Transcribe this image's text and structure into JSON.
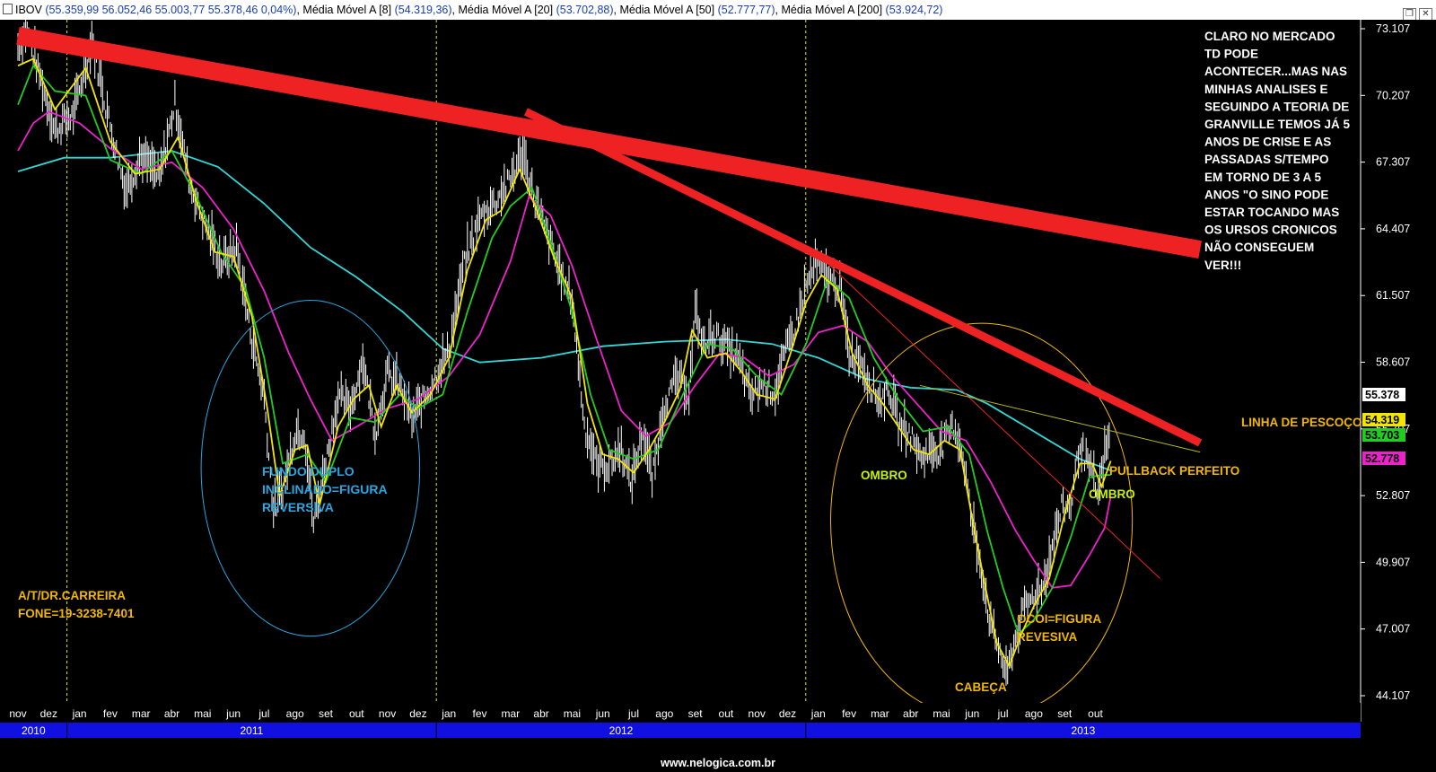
{
  "header": {
    "symbol": "IBOV",
    "ohlc": "(55.359,99  56.052,46  55.003,77  55.378,46  0,04%)",
    "ma": [
      {
        "label": "Média Móvel A [8]",
        "value": "(54.319,36)"
      },
      {
        "label": "Média Móvel A [20]",
        "value": "(53.702,88)"
      },
      {
        "label": "Média Móvel A [50]",
        "value": "(52.777,77)"
      },
      {
        "label": "Média Móvel A [200]",
        "value": "(53.924,72)"
      }
    ]
  },
  "footer": {
    "watermark": "www.nelogica.com.br"
  },
  "colors": {
    "background": "#000000",
    "price": "#ffffff",
    "ma8": "#f2e600",
    "ma20": "#22cc22",
    "ma50": "#ee22cc",
    "ma200": "#33d6d6",
    "trend": "#ee2222",
    "annot_blue": "#2aa6e0",
    "annot_orange": "#f2b800",
    "annot_green": "#c8f000",
    "axis_band": "#1010e0"
  },
  "chart_data": {
    "type": "line",
    "ylim": [
      44107,
      73107
    ],
    "y_ticks": [
      "73.107",
      "70.207",
      "67.307",
      "64.407",
      "61.507",
      "58.607",
      "55.707",
      "52.807",
      "49.907",
      "47.007",
      "44.107"
    ],
    "months": [
      "nov",
      "dez",
      "jan",
      "fev",
      "mar",
      "abr",
      "mai",
      "jun",
      "jul",
      "ago",
      "set",
      "out",
      "nov",
      "dez",
      "jan",
      "fev",
      "mar",
      "abr",
      "mai",
      "jun",
      "jul",
      "ago",
      "set",
      "out",
      "nov",
      "dez",
      "jan",
      "fev",
      "mar",
      "abr",
      "mai",
      "jun",
      "jul",
      "ago",
      "set",
      "out"
    ],
    "years": [
      "2010",
      "2011",
      "2012",
      "2013"
    ],
    "year_start_index": [
      0,
      2,
      14,
      26
    ],
    "price_keypoints": [
      [
        0,
        72200
      ],
      [
        0.3,
        73000
      ],
      [
        0.7,
        71000
      ],
      [
        1.2,
        68600
      ],
      [
        1.8,
        69300
      ],
      [
        2.4,
        72500
      ],
      [
        3.0,
        68800
      ],
      [
        3.5,
        66000
      ],
      [
        4.0,
        67500
      ],
      [
        4.6,
        66500
      ],
      [
        5.1,
        69800
      ],
      [
        5.6,
        66200
      ],
      [
        6.1,
        64500
      ],
      [
        6.6,
        62800
      ],
      [
        7.1,
        63500
      ],
      [
        7.6,
        59500
      ],
      [
        8.0,
        57000
      ],
      [
        8.3,
        52000
      ],
      [
        8.6,
        53000
      ],
      [
        9.0,
        55500
      ],
      [
        9.3,
        55500
      ],
      [
        9.6,
        51500
      ],
      [
        9.9,
        53500
      ],
      [
        10.4,
        57000
      ],
      [
        10.8,
        56500
      ],
      [
        11.2,
        58600
      ],
      [
        11.6,
        55500
      ],
      [
        12.0,
        58000
      ],
      [
        12.4,
        57500
      ],
      [
        12.8,
        56000
      ],
      [
        13.2,
        57000
      ],
      [
        13.6,
        58000
      ],
      [
        14.0,
        59000
      ],
      [
        14.5,
        62800
      ],
      [
        15.0,
        64800
      ],
      [
        15.5,
        65500
      ],
      [
        16.0,
        66500
      ],
      [
        16.4,
        67600
      ],
      [
        16.8,
        65500
      ],
      [
        17.2,
        64000
      ],
      [
        17.6,
        62500
      ],
      [
        18.0,
        61200
      ],
      [
        18.4,
        55800
      ],
      [
        18.8,
        54000
      ],
      [
        19.2,
        54000
      ],
      [
        19.6,
        54800
      ],
      [
        19.9,
        53200
      ],
      [
        20.3,
        55500
      ],
      [
        20.6,
        53400
      ],
      [
        21.0,
        56700
      ],
      [
        21.4,
        57800
      ],
      [
        21.8,
        57200
      ],
      [
        22.0,
        60600
      ],
      [
        22.3,
        59200
      ],
      [
        22.6,
        59800
      ],
      [
        23.0,
        59200
      ],
      [
        23.4,
        58600
      ],
      [
        23.8,
        57000
      ],
      [
        24.2,
        57600
      ],
      [
        24.6,
        57200
      ],
      [
        24.9,
        58800
      ],
      [
        25.3,
        60300
      ],
      [
        25.6,
        61800
      ],
      [
        25.9,
        62800
      ],
      [
        26.3,
        62200
      ],
      [
        26.7,
        61800
      ],
      [
        27.0,
        58800
      ],
      [
        27.3,
        58800
      ],
      [
        27.6,
        57800
      ],
      [
        28.0,
        56800
      ],
      [
        28.3,
        57400
      ],
      [
        28.6,
        55800
      ],
      [
        29.0,
        55400
      ],
      [
        29.3,
        54400
      ],
      [
        29.6,
        54600
      ],
      [
        30.0,
        54800
      ],
      [
        30.4,
        55800
      ],
      [
        30.7,
        54500
      ],
      [
        31.0,
        51500
      ],
      [
        31.3,
        49500
      ],
      [
        31.6,
        47000
      ],
      [
        31.9,
        46000
      ],
      [
        32.1,
        44800
      ],
      [
        32.4,
        46500
      ],
      [
        32.7,
        47800
      ],
      [
        33.0,
        48400
      ],
      [
        33.3,
        48800
      ],
      [
        33.6,
        50500
      ],
      [
        33.9,
        52200
      ],
      [
        34.2,
        52300
      ],
      [
        34.5,
        55000
      ],
      [
        34.8,
        53900
      ],
      [
        35.1,
        52700
      ],
      [
        35.3,
        54500
      ],
      [
        35.5,
        55400
      ]
    ],
    "ma200_keypoints": [
      [
        0,
        66900
      ],
      [
        1.5,
        67500
      ],
      [
        3.0,
        67500
      ],
      [
        5.0,
        67800
      ],
      [
        6.5,
        67100
      ],
      [
        8.0,
        65500
      ],
      [
        9.5,
        63600
      ],
      [
        11.0,
        62300
      ],
      [
        12.5,
        60800
      ],
      [
        13.8,
        59200
      ],
      [
        15.0,
        58600
      ],
      [
        17.0,
        58800
      ],
      [
        19.0,
        59300
      ],
      [
        21.0,
        59500
      ],
      [
        23.0,
        59600
      ],
      [
        24.5,
        59400
      ],
      [
        26.0,
        58800
      ],
      [
        27.5,
        57900
      ],
      [
        29.0,
        57500
      ],
      [
        30.5,
        57400
      ],
      [
        31.5,
        56800
      ],
      [
        32.5,
        56000
      ],
      [
        33.5,
        55200
      ],
      [
        34.5,
        54400
      ],
      [
        35.5,
        53900
      ]
    ],
    "ma50_keypoints": [
      [
        0,
        67800
      ],
      [
        0.5,
        69000
      ],
      [
        1.0,
        69500
      ],
      [
        2.0,
        69000
      ],
      [
        3.0,
        67900
      ],
      [
        4.0,
        67000
      ],
      [
        5.0,
        67300
      ],
      [
        6.0,
        66200
      ],
      [
        7.0,
        64400
      ],
      [
        8.0,
        61700
      ],
      [
        8.8,
        59000
      ],
      [
        9.5,
        57000
      ],
      [
        10.2,
        55200
      ],
      [
        11.0,
        55800
      ],
      [
        12.0,
        56600
      ],
      [
        13.0,
        57000
      ],
      [
        14.0,
        58000
      ],
      [
        15.0,
        59800
      ],
      [
        16.0,
        63000
      ],
      [
        16.6,
        65800
      ],
      [
        17.3,
        65000
      ],
      [
        18.0,
        62800
      ],
      [
        18.8,
        59600
      ],
      [
        19.6,
        56500
      ],
      [
        20.4,
        55400
      ],
      [
        21.2,
        56000
      ],
      [
        22.0,
        57600
      ],
      [
        22.8,
        59000
      ],
      [
        23.6,
        58800
      ],
      [
        24.4,
        58000
      ],
      [
        25.2,
        58500
      ],
      [
        26.0,
        59900
      ],
      [
        26.8,
        60200
      ],
      [
        27.6,
        59500
      ],
      [
        28.4,
        58000
      ],
      [
        29.2,
        56800
      ],
      [
        30.0,
        55600
      ],
      [
        30.8,
        55200
      ],
      [
        31.6,
        53400
      ],
      [
        32.4,
        51300
      ],
      [
        33.0,
        50000
      ],
      [
        33.6,
        48800
      ],
      [
        34.2,
        48900
      ],
      [
        34.8,
        50200
      ],
      [
        35.3,
        51400
      ],
      [
        35.5,
        52778
      ]
    ],
    "ma20_keypoints": [
      [
        0,
        69800
      ],
      [
        0.5,
        71500
      ],
      [
        1.2,
        70400
      ],
      [
        2.2,
        70200
      ],
      [
        3.0,
        67400
      ],
      [
        4.0,
        66800
      ],
      [
        5.0,
        67800
      ],
      [
        5.8,
        65800
      ],
      [
        6.6,
        63400
      ],
      [
        7.4,
        61800
      ],
      [
        8.0,
        58800
      ],
      [
        8.6,
        54200
      ],
      [
        9.4,
        54600
      ],
      [
        10.0,
        53400
      ],
      [
        10.8,
        56200
      ],
      [
        11.6,
        56000
      ],
      [
        12.4,
        57200
      ],
      [
        13.0,
        56600
      ],
      [
        13.8,
        57200
      ],
      [
        14.6,
        60800
      ],
      [
        15.4,
        64000
      ],
      [
        16.0,
        65400
      ],
      [
        16.7,
        66200
      ],
      [
        17.4,
        63400
      ],
      [
        18.0,
        60800
      ],
      [
        18.6,
        57200
      ],
      [
        19.2,
        54800
      ],
      [
        20.0,
        54400
      ],
      [
        20.8,
        54800
      ],
      [
        21.6,
        57200
      ],
      [
        22.4,
        59400
      ],
      [
        23.2,
        59200
      ],
      [
        24.0,
        58000
      ],
      [
        24.8,
        57200
      ],
      [
        25.6,
        59400
      ],
      [
        26.3,
        62200
      ],
      [
        27.0,
        61400
      ],
      [
        27.8,
        58800
      ],
      [
        28.6,
        57000
      ],
      [
        29.4,
        55600
      ],
      [
        30.2,
        55800
      ],
      [
        30.9,
        54600
      ],
      [
        31.5,
        51200
      ],
      [
        32.0,
        48800
      ],
      [
        32.5,
        46800
      ],
      [
        33.0,
        47400
      ],
      [
        33.6,
        48800
      ],
      [
        34.2,
        51000
      ],
      [
        34.8,
        53600
      ],
      [
        35.2,
        53700
      ],
      [
        35.5,
        53703
      ]
    ],
    "ma8_keypoints": [
      [
        0,
        71500
      ],
      [
        0.5,
        71800
      ],
      [
        1.2,
        69600
      ],
      [
        2.2,
        71400
      ],
      [
        3.0,
        68200
      ],
      [
        3.8,
        66800
      ],
      [
        4.6,
        67000
      ],
      [
        5.2,
        68400
      ],
      [
        5.8,
        65600
      ],
      [
        6.4,
        63400
      ],
      [
        7.0,
        63200
      ],
      [
        7.6,
        60600
      ],
      [
        8.1,
        56600
      ],
      [
        8.5,
        52800
      ],
      [
        9.0,
        54800
      ],
      [
        9.4,
        55000
      ],
      [
        9.8,
        52400
      ],
      [
        10.4,
        55800
      ],
      [
        10.9,
        57000
      ],
      [
        11.4,
        57600
      ],
      [
        11.8,
        55800
      ],
      [
        12.3,
        57600
      ],
      [
        12.8,
        56400
      ],
      [
        13.4,
        57200
      ],
      [
        14.0,
        58800
      ],
      [
        14.6,
        62600
      ],
      [
        15.2,
        64800
      ],
      [
        15.7,
        65200
      ],
      [
        16.3,
        67000
      ],
      [
        16.8,
        65400
      ],
      [
        17.4,
        63200
      ],
      [
        18.0,
        61400
      ],
      [
        18.5,
        56800
      ],
      [
        19.0,
        54600
      ],
      [
        19.5,
        54400
      ],
      [
        20.0,
        53800
      ],
      [
        20.5,
        54800
      ],
      [
        21.0,
        56000
      ],
      [
        21.5,
        57400
      ],
      [
        21.9,
        60000
      ],
      [
        22.4,
        58800
      ],
      [
        23.0,
        59000
      ],
      [
        23.5,
        58200
      ],
      [
        24.0,
        57200
      ],
      [
        24.6,
        57000
      ],
      [
        25.1,
        59000
      ],
      [
        25.6,
        61200
      ],
      [
        26.1,
        62400
      ],
      [
        26.6,
        61800
      ],
      [
        27.1,
        59000
      ],
      [
        27.6,
        57600
      ],
      [
        28.1,
        56800
      ],
      [
        28.6,
        55800
      ],
      [
        29.1,
        54800
      ],
      [
        29.6,
        54600
      ],
      [
        30.1,
        55200
      ],
      [
        30.6,
        54800
      ],
      [
        31.0,
        51800
      ],
      [
        31.4,
        49000
      ],
      [
        31.8,
        46400
      ],
      [
        32.2,
        45400
      ],
      [
        32.6,
        46800
      ],
      [
        33.0,
        48000
      ],
      [
        33.5,
        49200
      ],
      [
        34.0,
        52000
      ],
      [
        34.5,
        54200
      ],
      [
        34.9,
        54200
      ],
      [
        35.2,
        53200
      ],
      [
        35.5,
        54319
      ]
    ],
    "last_values": [
      {
        "label": "55.378",
        "value": 55378,
        "color": "#ffffff",
        "text": "#000000"
      },
      {
        "label": "54.319",
        "value": 54319,
        "color": "#f2e600",
        "text": "#000000"
      },
      {
        "label": "53.703",
        "value": 53703,
        "color": "#22cc22",
        "text": "#000000"
      },
      {
        "label": "52.778",
        "value": 52778,
        "color": "#ee22cc",
        "text": "#000000"
      }
    ],
    "trendlines": [
      {
        "from": [
          0,
          72800
        ],
        "to": [
          38.4,
          63500
        ],
        "width": 20
      },
      {
        "from": [
          16.5,
          69500
        ],
        "to": [
          38.4,
          55100
        ],
        "width": 9
      },
      {
        "from": [
          26.0,
          63300
        ],
        "to": [
          37.1,
          49200
        ],
        "width": 1
      },
      {
        "from": [
          29.3,
          57600
        ],
        "to": [
          38.4,
          54700
        ],
        "width": 1,
        "color": "#b8b820"
      }
    ],
    "ellipses": [
      {
        "cx": 9.5,
        "cy": 54000,
        "rx": 3.55,
        "ry": 7300,
        "color": "#2aa6e0"
      },
      {
        "cx": 31.3,
        "cy": 51700,
        "rx": 4.9,
        "ry": 8600,
        "color": "#f2b800"
      }
    ],
    "annotations": [
      {
        "text": "CLARO NO MERCADO\nTD PODE\nACONTECER...MAS NAS\nMINHAS ANALISES E\nSEGUINDO A TEORIA DE\nGRANVILLE TEMOS JÁ 5\nANOS DE CRISE E AS\nPASSADAS S/TEMPO\nEM TORNO DE 3 A 5\nANOS \"O SINO PODE\nESTAR TOCANDO MAS\nOS URSOS CRONICOS\nNÃO CONSEGUEM\nVER!!!",
        "color": "#ffffff"
      },
      {
        "text": "FUNDO DUPLO\nINCLINADO=FIGURA\nREVERSIVA",
        "color": "#2aa6e0"
      },
      {
        "text": "A/T/DR.CARREIRA\nFONE=19-3238-7401",
        "color": "#f2b800"
      },
      {
        "text": "OMBRO",
        "color": "#c8f000"
      },
      {
        "text": "OMBRO",
        "color": "#c8f000"
      },
      {
        "text": "CABEÇA",
        "color": "#f2b800"
      },
      {
        "text": "OCOI=FIGURA\nREVESIVA",
        "color": "#f2b800"
      },
      {
        "text": "PULLBACK PERFEITO",
        "color": "#f2b800"
      },
      {
        "text": "LINHA DE PESCOÇO",
        "color": "#f2b800"
      }
    ]
  }
}
